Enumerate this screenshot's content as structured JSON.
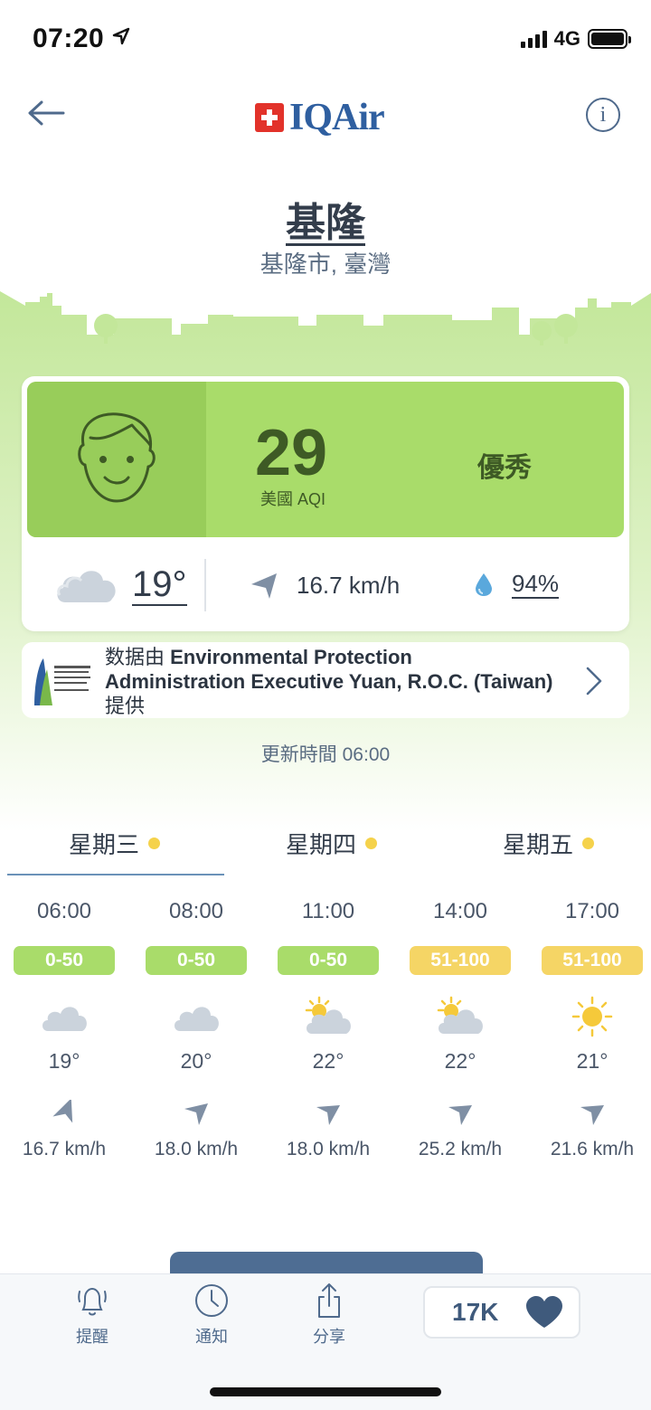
{
  "status": {
    "time": "07:20",
    "network": "4G"
  },
  "header": {
    "logo_text": "IQAir",
    "info_label": "i"
  },
  "location": {
    "city": "基隆",
    "region": "基隆市, 臺灣"
  },
  "aqi": {
    "value": "29",
    "unit": "美國 AQI",
    "level": "優秀",
    "color": "#a9dc6a"
  },
  "current_weather": {
    "temperature": "19°",
    "wind": "16.7 km/h",
    "humidity": "94%"
  },
  "source": {
    "prefix": "数据由 ",
    "name": "Environmental Protection Administration Executive Yuan, R.O.C. (Taiwan)",
    "suffix": "提供"
  },
  "updated": "更新時間 06:00",
  "days": [
    {
      "label": "星期三",
      "dot_color": "#f5d24b"
    },
    {
      "label": "星期四",
      "dot_color": "#f5d24b"
    },
    {
      "label": "星期五",
      "dot_color": "#f5d24b"
    }
  ],
  "hourly": [
    {
      "time": "06:00",
      "aqi_range": "0-50",
      "color": "#a9dc6a",
      "icon": "cloud-icon",
      "temp": "19°",
      "wind": "16.7 km/h"
    },
    {
      "time": "08:00",
      "aqi_range": "0-50",
      "color": "#a9dc6a",
      "icon": "cloud-icon",
      "temp": "20°",
      "wind": "18.0 km/h"
    },
    {
      "time": "11:00",
      "aqi_range": "0-50",
      "color": "#a9dc6a",
      "icon": "partly-cloudy-icon",
      "temp": "22°",
      "wind": "18.0 km/h"
    },
    {
      "time": "14:00",
      "aqi_range": "51-100",
      "color": "#f5d565",
      "icon": "partly-cloudy-icon",
      "temp": "22°",
      "wind": "25.2 km/h"
    },
    {
      "time": "17:00",
      "aqi_range": "51-100",
      "color": "#f5d565",
      "icon": "sun-icon",
      "temp": "21°",
      "wind": "21.6 km/h"
    }
  ],
  "bottom_nav": {
    "alert": "提醒",
    "notify": "通知",
    "share": "分享",
    "likes": "17K"
  }
}
